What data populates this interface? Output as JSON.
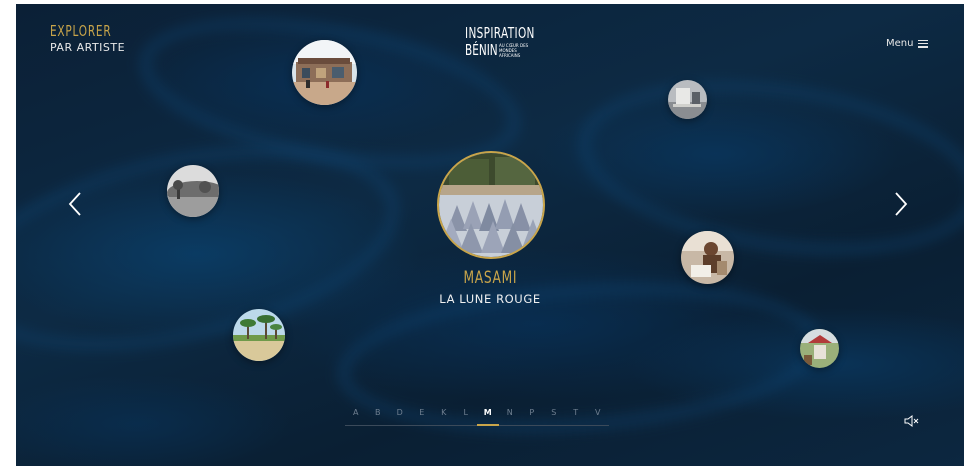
{
  "header": {
    "explorer_title": "EXPLORER",
    "explorer_subtitle": "PAR ARTISTE",
    "logo_line1": "INSPIRATION",
    "logo_line2": "BÉNIN",
    "logo_tagline": "AU CŒUR DES MONDES AFRICAINS",
    "menu_label": "Menu"
  },
  "featured": {
    "artist": "MASAMI",
    "work": "LA LUNE ROUGE"
  },
  "alphabet": {
    "letters": [
      "A",
      "B",
      "D",
      "E",
      "K",
      "L",
      "M",
      "N",
      "P",
      "S",
      "T",
      "V"
    ],
    "active": "M"
  },
  "icons": {
    "prev": "chevron-left-icon",
    "next": "chevron-right-icon",
    "menu": "hamburger-icon",
    "sound": "speaker-muted-icon"
  },
  "colors": {
    "accent": "#c9a54a",
    "background": "#0c2640"
  }
}
